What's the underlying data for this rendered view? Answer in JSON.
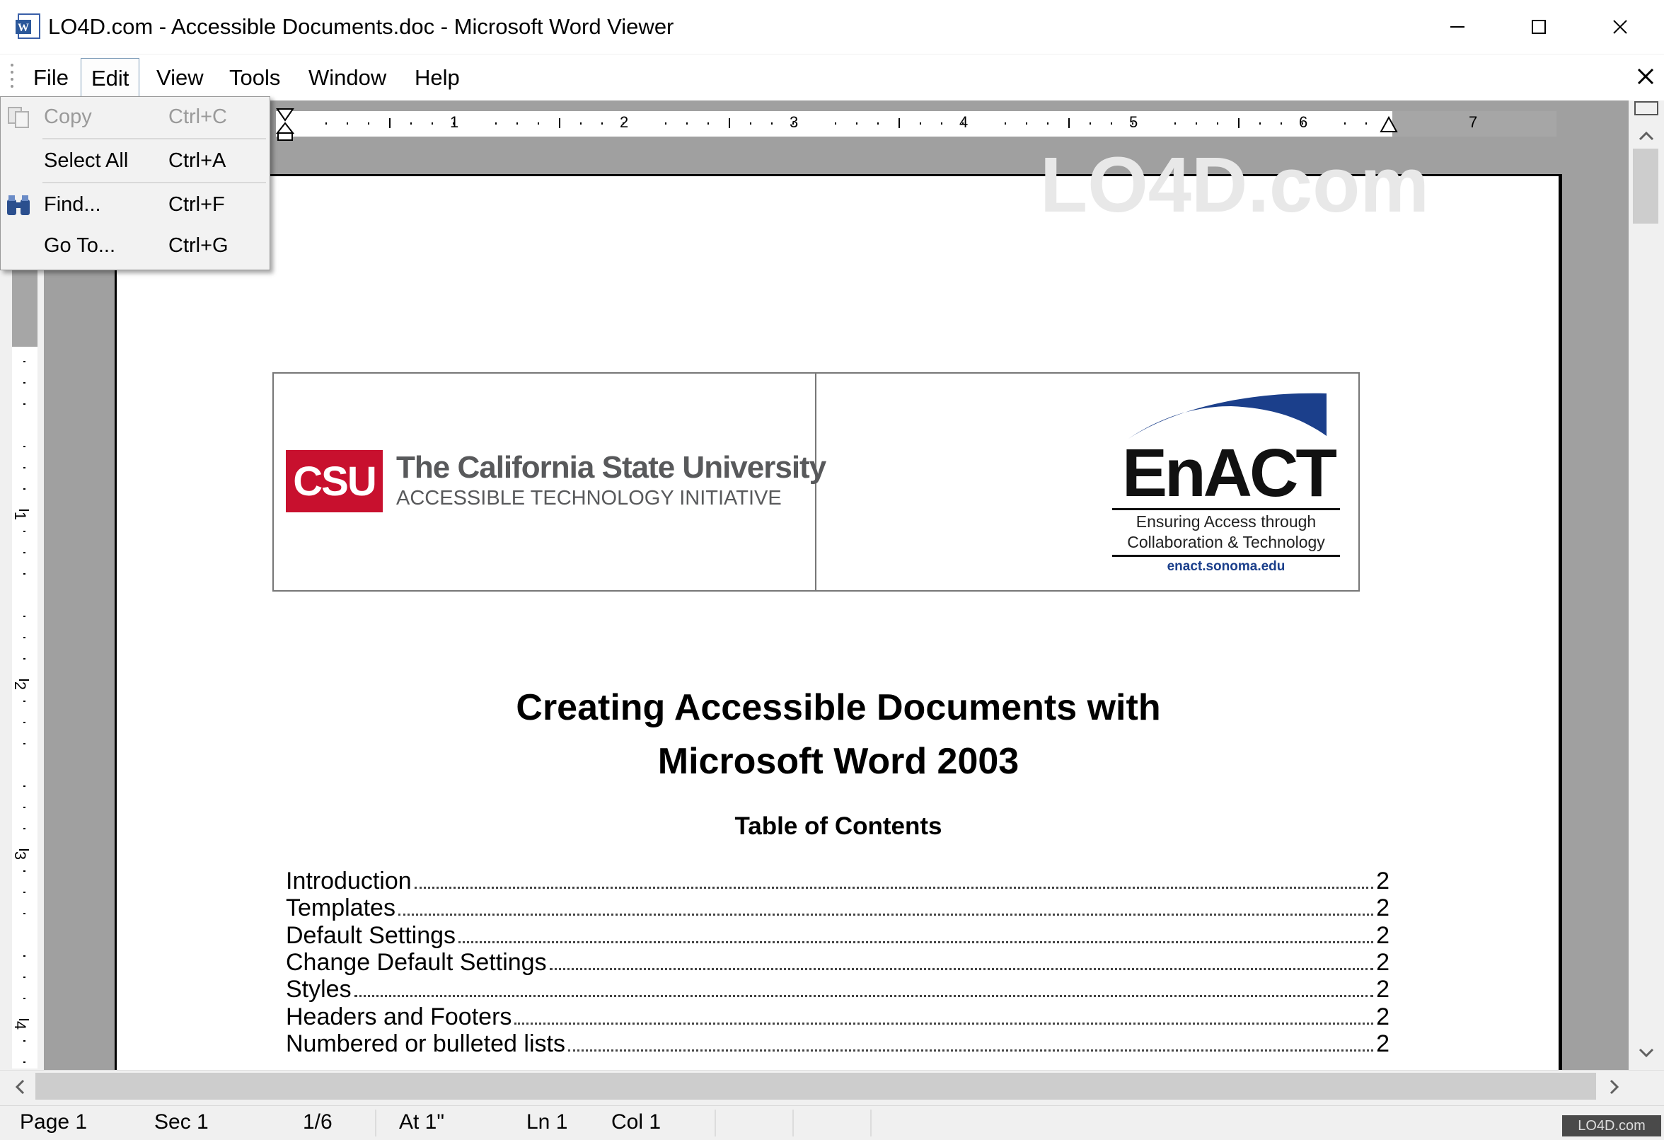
{
  "window": {
    "title": "LO4D.com - Accessible Documents.doc - Microsoft Word Viewer"
  },
  "menu": {
    "items": [
      {
        "label": "File"
      },
      {
        "label": "Edit"
      },
      {
        "label": "View"
      },
      {
        "label": "Tools"
      },
      {
        "label": "Window"
      },
      {
        "label": "Help"
      }
    ]
  },
  "edit_menu": {
    "items": [
      {
        "label": "Copy",
        "shortcut": "Ctrl+C",
        "enabled": false
      },
      {
        "label": "Select All",
        "shortcut": "Ctrl+A",
        "enabled": true
      },
      {
        "label": "Find...",
        "shortcut": "Ctrl+F",
        "enabled": true
      },
      {
        "label": "Go To...",
        "shortcut": "Ctrl+G",
        "enabled": true
      }
    ]
  },
  "ruler": {
    "horizontal_numbers": [
      "1",
      "2",
      "3",
      "4",
      "5",
      "6",
      "7"
    ],
    "vertical_numbers": [
      "1",
      "2",
      "3",
      "4"
    ]
  },
  "document": {
    "csu_logo_text": "CSU",
    "csu_name": "The California State University",
    "csu_subtitle": "ACCESSIBLE TECHNOLOGY INITIATIVE",
    "enact_logo_text": "EnACT",
    "enact_tagline_1": "Ensuring Access through",
    "enact_tagline_2": "Collaboration & Technology",
    "enact_url": "enact.sonoma.edu",
    "title_line1": "Creating Accessible Documents with",
    "title_line2": "Microsoft Word 2003",
    "toc_heading": "Table of Contents",
    "toc": [
      {
        "title": "Introduction",
        "page": "2"
      },
      {
        "title": "Templates",
        "page": "2"
      },
      {
        "title": "Default Settings",
        "page": "2"
      },
      {
        "title": "Change Default Settings",
        "page": "2"
      },
      {
        "title": "Styles",
        "page": "2"
      },
      {
        "title": "Headers and Footers",
        "page": "2"
      },
      {
        "title": "Numbered or bulleted lists",
        "page": "2"
      }
    ]
  },
  "watermark": "LO4D.com",
  "status": {
    "page": "Page 1",
    "sec": "Sec 1",
    "pages": "1/6",
    "at": "At 1\"",
    "ln": "Ln 1",
    "col": "Col 1"
  },
  "colors": {
    "csu_red": "#c8102e",
    "enact_blue": "#1b3f8b",
    "workspace_gray": "#a0a0a0"
  }
}
